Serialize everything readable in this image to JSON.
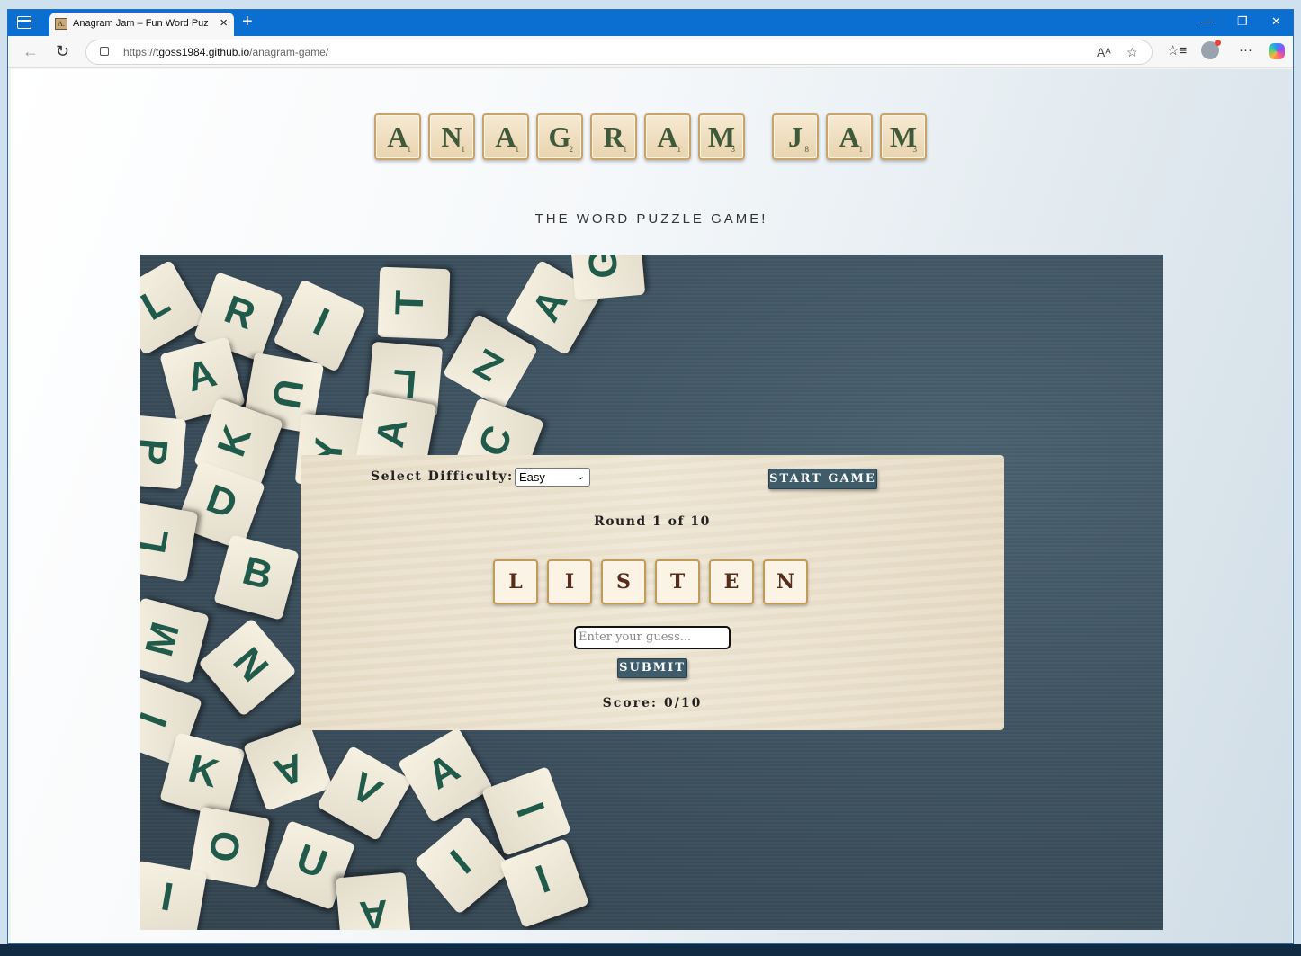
{
  "browser": {
    "tab_title": "Anagram Jam – Fun Word Puzzle",
    "tab_favicon": "A.",
    "url_prefix": "https://",
    "url_host": "tgoss1984.github.io",
    "url_path": "/anagram-game/"
  },
  "header": {
    "logo_tiles": [
      {
        "letter": "A",
        "points": "1"
      },
      {
        "letter": "N",
        "points": "1"
      },
      {
        "letter": "A",
        "points": "1"
      },
      {
        "letter": "G",
        "points": "2"
      },
      {
        "letter": "R",
        "points": "1"
      },
      {
        "letter": "A",
        "points": "1"
      },
      {
        "letter": "M",
        "points": "3"
      },
      {
        "letter": "J",
        "points": "8"
      },
      {
        "letter": "A",
        "points": "1"
      },
      {
        "letter": "M",
        "points": "3"
      }
    ],
    "subtitle": "THE WORD PUZZLE GAME!"
  },
  "game": {
    "difficulty_label": "Select Difficulty:",
    "difficulty_value": "Easy",
    "start_button": "START GAME",
    "round_text": "Round 1 of 10",
    "word_letters": [
      "L",
      "I",
      "S",
      "T",
      "E",
      "N"
    ],
    "guess_placeholder": "Enter your guess...",
    "submit_button": "SUBMIT",
    "score_text": "Score: 0/10"
  },
  "colors": {
    "accent": "#0b6fd1",
    "button": "#3f5c6b",
    "tile_letter": "#3e5a3b",
    "word_letter": "#5a2b1a"
  }
}
